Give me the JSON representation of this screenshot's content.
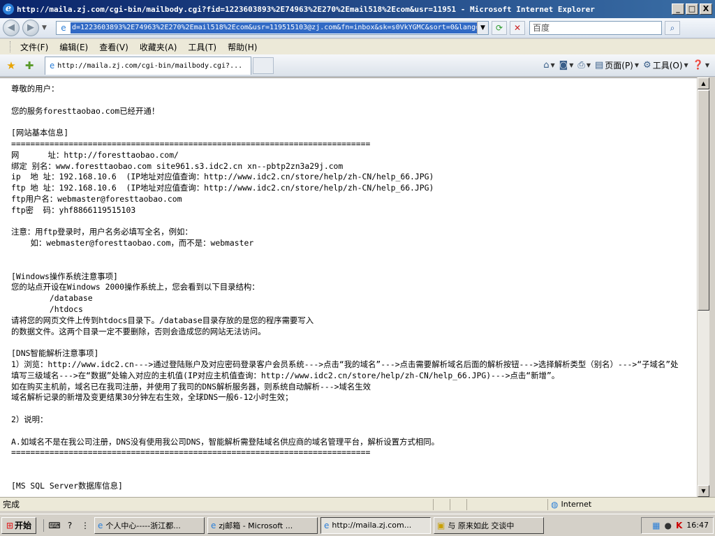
{
  "window": {
    "title": "http://maila.zj.com/cgi-bin/mailbody.cgi?fid=1223603893%2E74963%2E270%2Email518%2Ecom&usr=11951 - Microsoft Internet Explorer",
    "minimize": "_",
    "maximize": "□",
    "close": "X"
  },
  "address": {
    "url": "d=1223603893%2E74963%2E270%2Email518%2Ecom&usr=119515103@zj.com&fn=inbox&sk=s0VkYGMC&sort=0&lang=gb",
    "search_placeholder": "百度"
  },
  "menu": [
    "文件(F)",
    "编辑(E)",
    "查看(V)",
    "收藏夹(A)",
    "工具(T)",
    "帮助(H)"
  ],
  "tab": {
    "label": "http://maila.zj.com/cgi-bin/mailbody.cgi?..."
  },
  "commands": {
    "page": "页面(P)",
    "tools": "工具(O)"
  },
  "mail_body": "尊敬的用户：\n\n您的服务foresttaobao.com已经开通！\n\n[网站基本信息]\n===========================================================================\n网      址：http://foresttaobao.com/\n绑定 别名：www.foresttaobao.com site961.s3.idc2.cn xn--pbtp2zn3a29j.com\nip  地 址：192.168.10.6  (IP地址对应值查询：http://www.idc2.cn/store/help/zh-CN/help_66.JPG)\nftp 地 址：192.168.10.6  (IP地址对应值查询：http://www.idc2.cn/store/help/zh-CN/help_66.JPG)\nftp用户名：webmaster@foresttaobao.com\nftp密  码：yhf8866119515103\n\n注意：用ftp登录时，用户名务必填写全名，例如：\n    如：webmaster@foresttaobao.com，而不是：webmaster\n\n\n[Windows操作系统注意事项]\n您的站点开设在Windows 2000操作系统上，您会看到以下目录结构：\n        /database\n        /htdocs\n请将您的网页文件上传到htdocs目录下。/database目录存放的是您的程序需要写入\n的数据文件。这两个目录一定不要删除，否则会造成您的网站无法访问。\n\n[DNS智能解析注意事项]\n1）浏览：http://www.idc2.cn--->通过登陆账户及对应密码登录客户会员系统--->点击“我的域名”--->点击需要解析域名后面的解析按钮--->选择解析类型（别名）--->“子域名”处填写三级域名--->在“数据”处输入对应的主机值(IP对应主机值查询：http://www.idc2.cn/store/help/zh-CN/help_66.JPG)--->点击“新增”。\n如在购买主机前，域名已在我司注册，并使用了我司的DNS解析服务器，则系统自动解析--->域名生效\n域名解析记录的新增及变更结果30分钟左右生效，全球DNS一般6-12小时生效；\n\n2）说明：\n\nA.如域名不是在我公司注册，DNS没有使用我公司DNS，智能解析需登陆域名供应商的域名管理平台，解析设置方式相同。\n===========================================================================\n\n\n[MS SQL Server数据库信息]",
  "status": {
    "text": "完成",
    "zone": "Internet"
  },
  "taskbar": {
    "start": "开始",
    "tasks": [
      "个人中心-----浙江都...",
      "zj邮箱 - Microsoft ...",
      "http://maila.zj.com...",
      "与 原来如此 交谈中"
    ],
    "clock": "16:47"
  }
}
